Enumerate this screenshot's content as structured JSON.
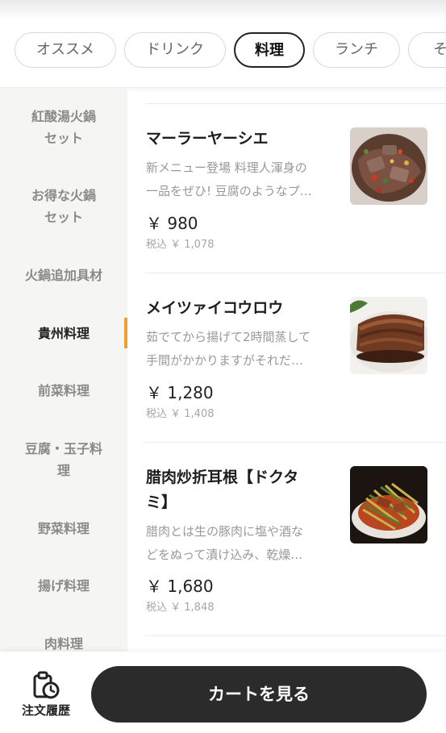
{
  "category_tabs": [
    {
      "label": "オススメ",
      "active": false
    },
    {
      "label": "ドリンク",
      "active": false
    },
    {
      "label": "料理",
      "active": true
    },
    {
      "label": "ランチ",
      "active": false
    },
    {
      "label": "そ",
      "active": false
    }
  ],
  "sidebar": {
    "items": [
      {
        "label": "紅酸湯火鍋\nセット",
        "active": false
      },
      {
        "label": "お得な火鍋\nセット",
        "active": false
      },
      {
        "label": "火鍋追加具材",
        "active": false
      },
      {
        "label": "貴州料理",
        "active": true
      },
      {
        "label": "前菜料理",
        "active": false
      },
      {
        "label": "豆腐・玉子料\n理",
        "active": false
      },
      {
        "label": "野菜料理",
        "active": false
      },
      {
        "label": "揚げ料理",
        "active": false
      },
      {
        "label": "肉料理",
        "active": false
      }
    ],
    "accent_color": "#f0a030"
  },
  "menu_items": [
    {
      "title": "マーラーヤーシエ",
      "description": "新メニュー登場 料理人渾身の\n一品をぜひ! 豆腐のようなプ…",
      "price": "￥ 980",
      "price_with_tax": "税込 ￥ 1,078",
      "image": "dish-photo-stirfry"
    },
    {
      "title": "メイツァイコウロウ",
      "description": "茹でてから揚げて2時間蒸して\n手間がかかりますがそれだ…",
      "price": "￥ 1,280",
      "price_with_tax": "税込 ￥ 1,408",
      "image": "dish-photo-pork-belly"
    },
    {
      "title": "腊肉炒折耳根【ドクタ\nミ】",
      "description": "腊肉とは生の豚肉に塩や酒な\nどをぬって漬け込み、乾燥…",
      "price": "￥ 1,680",
      "price_with_tax": "税込 ￥ 1,848",
      "image": "dish-photo-cured-pork"
    }
  ],
  "bottom_bar": {
    "history_label": "注文履歴",
    "history_icon": "clipboard-clock-icon",
    "cart_label": "カートを見る"
  }
}
